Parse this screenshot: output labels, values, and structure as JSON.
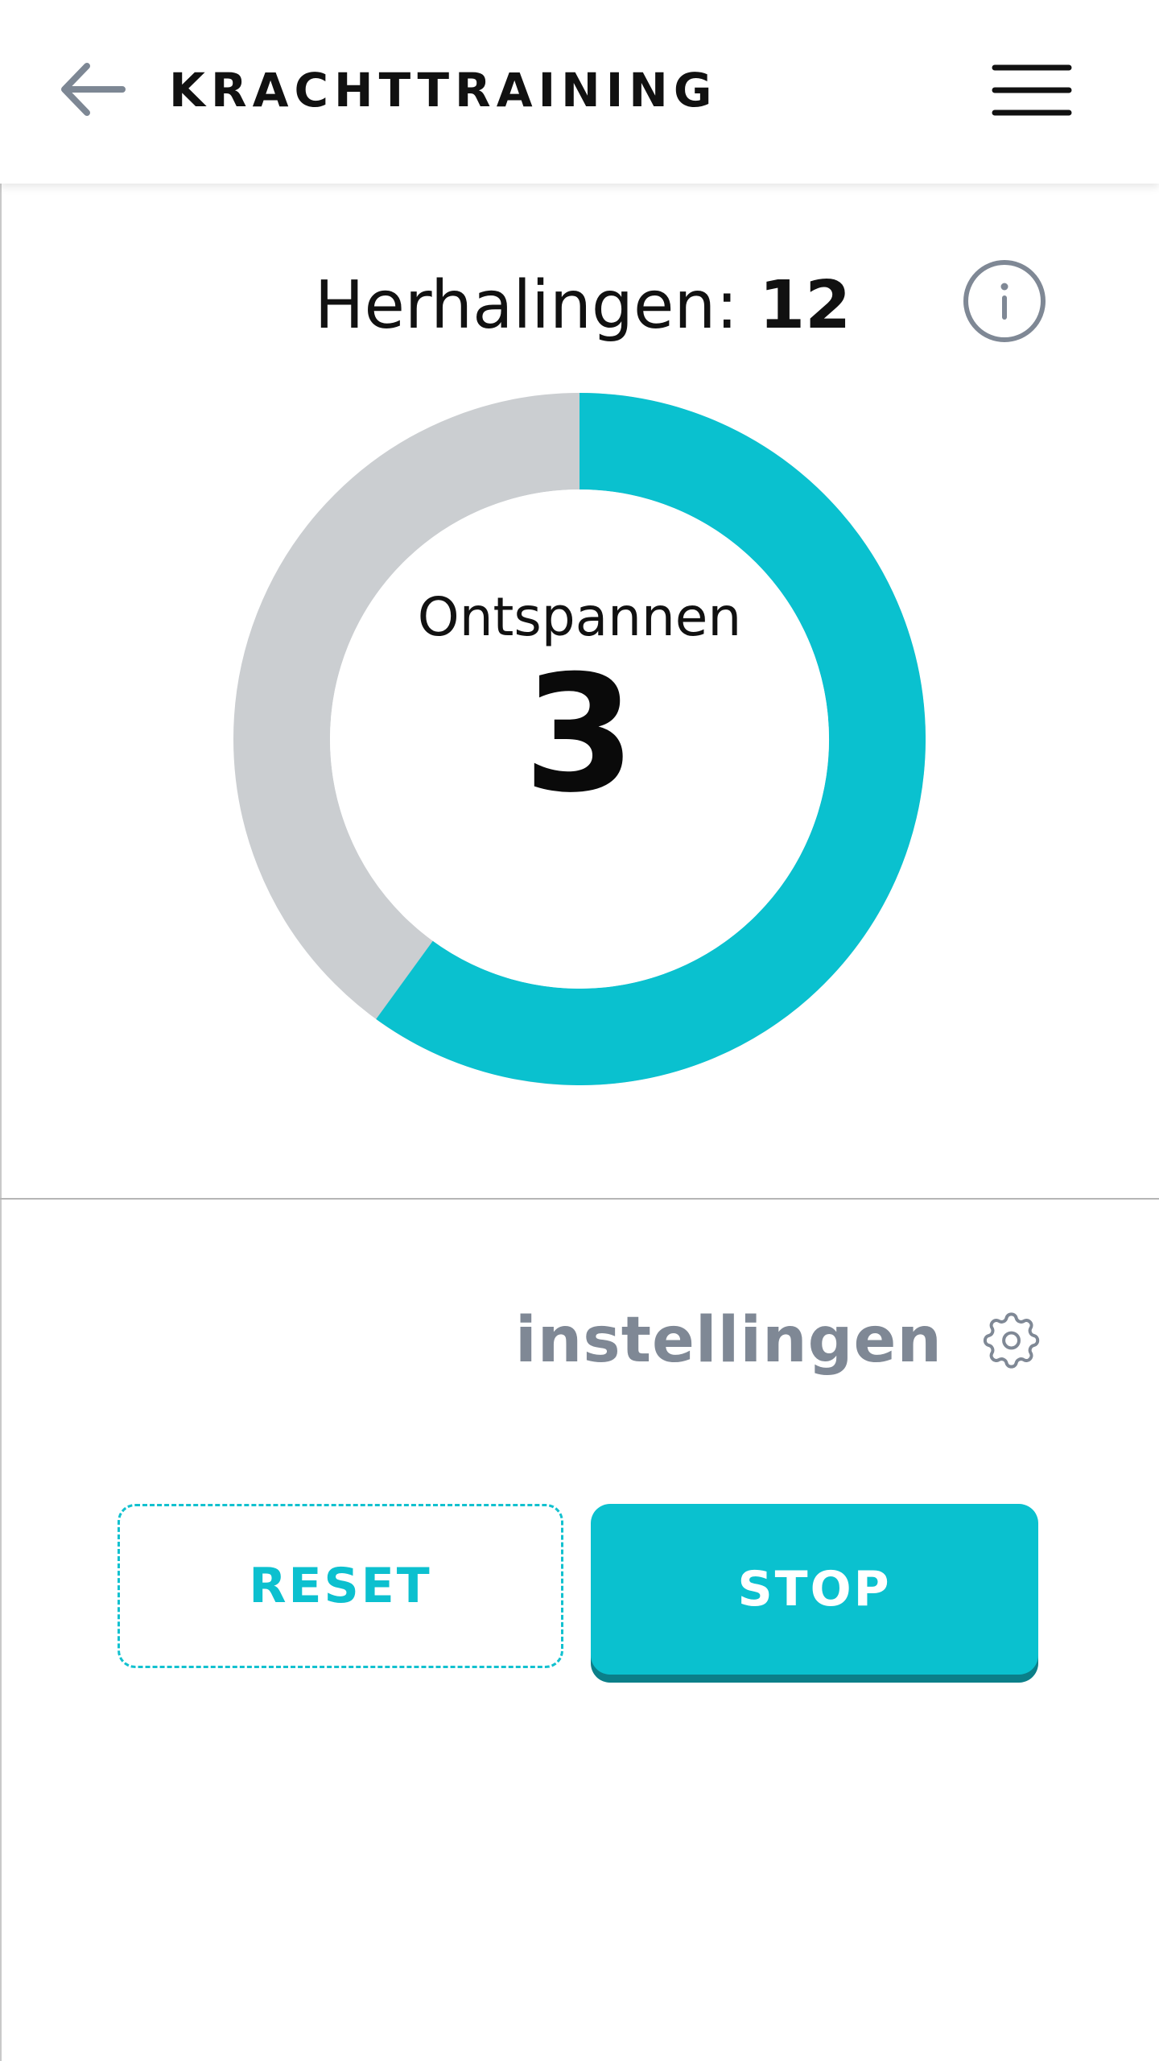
{
  "header": {
    "title": "KRACHTTRAINING",
    "back_icon": "arrow-left-icon",
    "menu_icon": "hamburger-menu-icon"
  },
  "repetitions": {
    "label": "Herhalingen:",
    "value": "12",
    "info_icon": "info-icon"
  },
  "timer": {
    "phase": "Ontspannen",
    "count": "3",
    "progress_fraction": 0.6,
    "colors": {
      "progress": "#0ac1cf",
      "track": "#cbced1",
      "inner": "#ffffff"
    }
  },
  "settings": {
    "label": "instellingen",
    "icon": "gear-icon"
  },
  "actions": {
    "reset_label": "RESET",
    "stop_label": "STOP"
  },
  "colors": {
    "accent": "#0ac1cf",
    "accent_dark": "#0b7f89",
    "muted": "#7f8895"
  }
}
